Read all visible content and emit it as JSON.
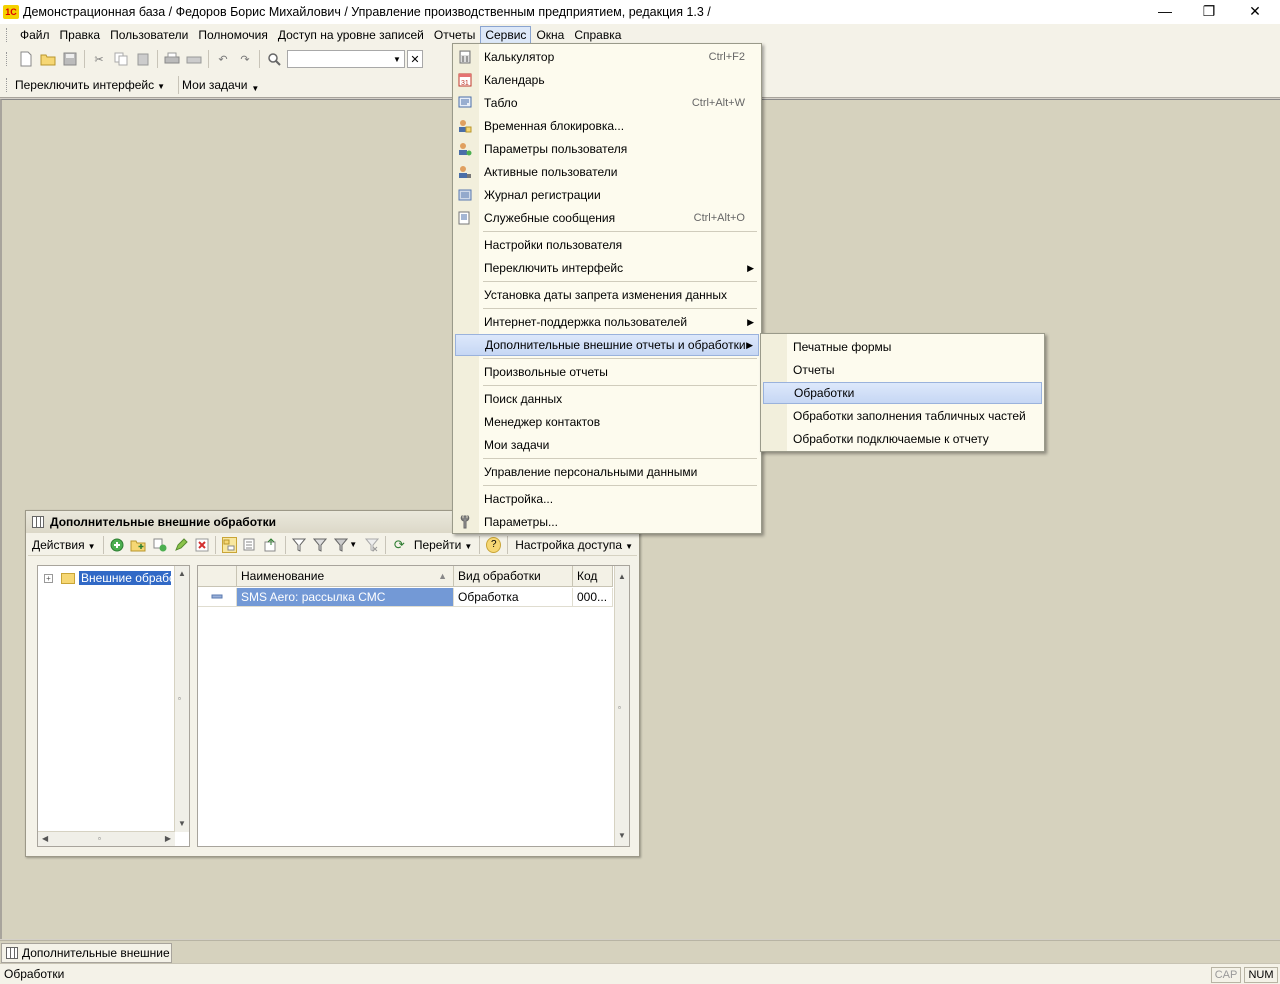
{
  "window": {
    "title": "Демонстрационная база / Федоров Борис Михайлович /  Управление производственным предприятием, редакция 1.3 /",
    "logo_text": "1C",
    "minimize": "—",
    "restore": "❐",
    "close": "✕"
  },
  "menubar": {
    "items": [
      "Файл",
      "Правка",
      "Пользователи",
      "Полномочия",
      "Доступ на уровне записей",
      "Отчеты",
      "Сервис",
      "Окна",
      "Справка"
    ],
    "active": "Сервис"
  },
  "panel": {
    "switch_interface": "Переключить интерфейс",
    "my_tasks": "Мои задачи"
  },
  "service_menu": {
    "items": [
      {
        "label": "Калькулятор",
        "shortcut": "Ctrl+F2"
      },
      {
        "label": "Календарь",
        "shortcut": ""
      },
      {
        "label": "Табло",
        "shortcut": "Ctrl+Alt+W"
      },
      {
        "label": "Временная блокировка...",
        "shortcut": ""
      },
      {
        "label": "Параметры пользователя",
        "shortcut": ""
      },
      {
        "label": "Активные пользователи",
        "shortcut": ""
      },
      {
        "label": "Журнал регистрации",
        "shortcut": ""
      },
      {
        "label": "Служебные сообщения",
        "shortcut": "Ctrl+Alt+O"
      },
      {
        "label": "Настройки пользователя",
        "shortcut": ""
      },
      {
        "label": "Переключить интерфейс",
        "shortcut": ""
      },
      {
        "label": "Установка даты запрета изменения данных",
        "shortcut": ""
      },
      {
        "label": "Интернет-поддержка пользователей",
        "shortcut": ""
      },
      {
        "label": "Дополнительные внешние отчеты и обработки",
        "shortcut": ""
      },
      {
        "label": "Произвольные отчеты",
        "shortcut": ""
      },
      {
        "label": "Поиск данных",
        "shortcut": ""
      },
      {
        "label": "Менеджер контактов",
        "shortcut": ""
      },
      {
        "label": "Мои задачи",
        "shortcut": ""
      },
      {
        "label": "Управление персональными данными",
        "shortcut": ""
      },
      {
        "label": "Настройка...",
        "shortcut": ""
      },
      {
        "label": "Параметры...",
        "shortcut": ""
      }
    ]
  },
  "submenu": {
    "items": [
      "Печатные формы",
      "Отчеты",
      "Обработки",
      "Обработки заполнения табличных частей",
      "Обработки подключаемые к отчету"
    ],
    "highlighted": "Обработки"
  },
  "inner_window": {
    "title": "Дополнительные внешние обработки",
    "actions": "Действия",
    "goto": "Перейти",
    "help": "?",
    "access_settings": "Настройка доступа",
    "tree_root": "Внешние обработки",
    "columns": [
      "Наименование",
      "Вид обработки",
      "Код"
    ],
    "rows": [
      {
        "name": "SMS Aero:  рассылка СМС",
        "kind": "Обработка",
        "code": "000..."
      }
    ]
  },
  "taskbar": {
    "task": "Дополнительные внешние ..."
  },
  "statusbar": {
    "text": "Обработки",
    "cap": "CAP",
    "num": "NUM"
  },
  "colors": {
    "highlight": "#c6d7f4",
    "selection": "#3169c6",
    "row_selected": "#7399d6",
    "workspace": "#d6d2be"
  }
}
